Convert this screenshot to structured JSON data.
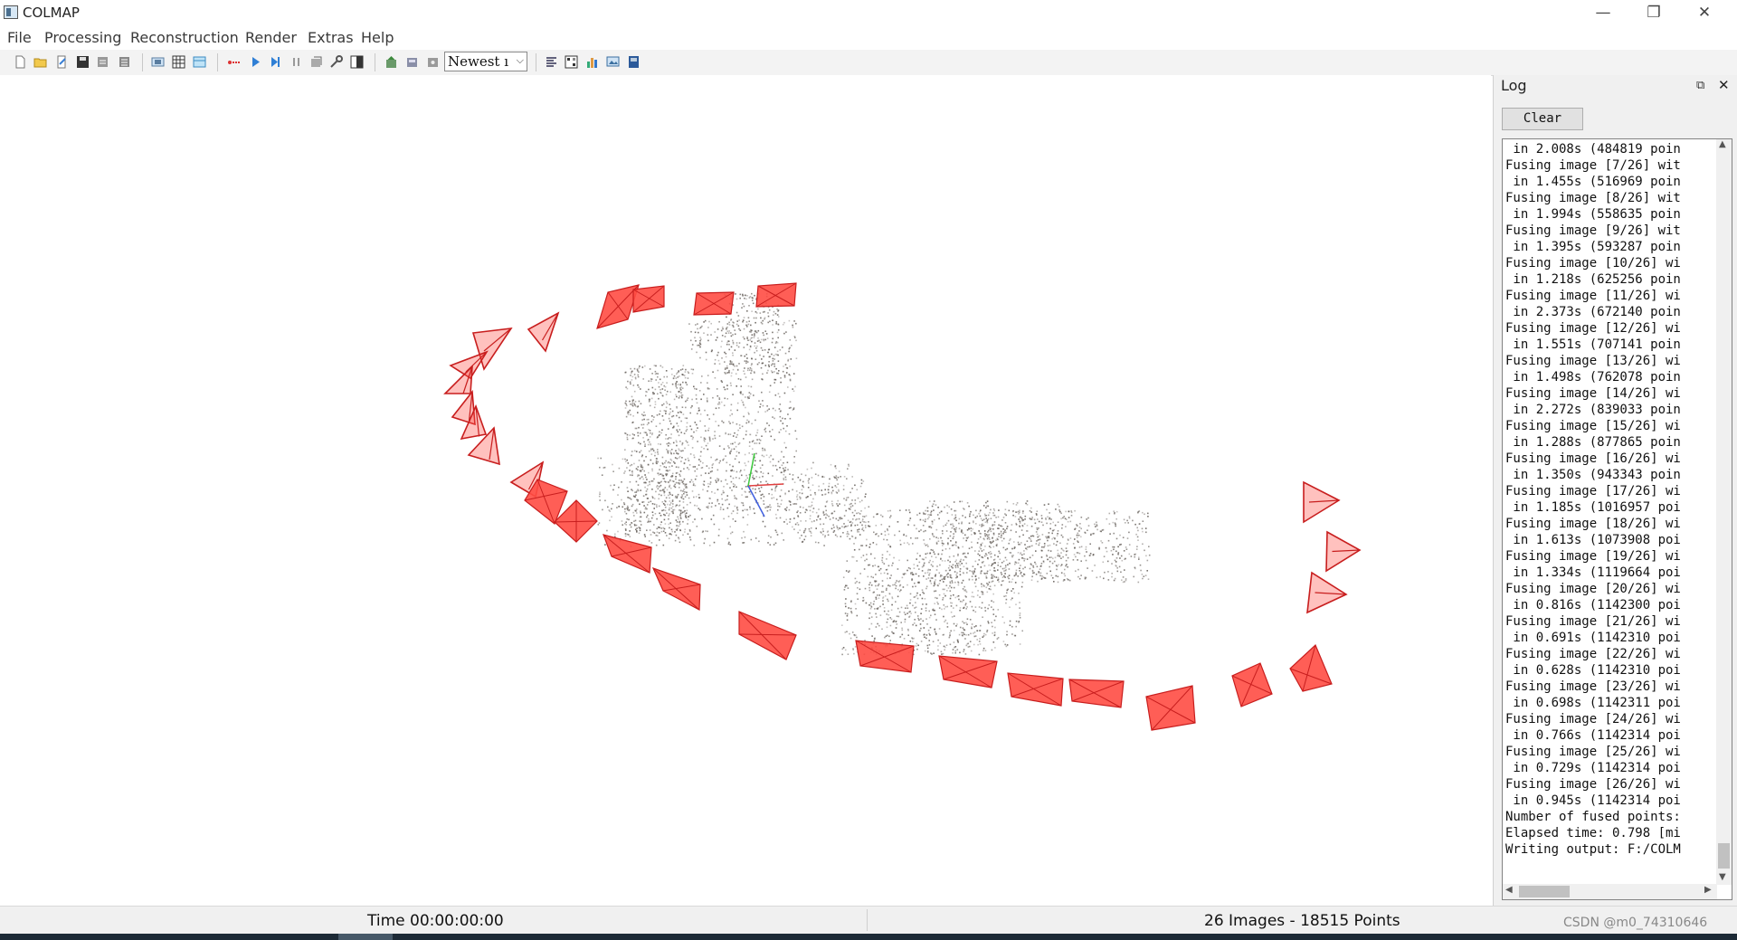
{
  "window": {
    "title": "COLMAP",
    "minimize": "—",
    "restore": "❐",
    "close": "✕"
  },
  "menu": [
    "File",
    "Processing",
    "Reconstruction",
    "Render",
    "Extras",
    "Help"
  ],
  "toolbar": {
    "selector_value": "Newest ı",
    "icons": [
      "new-project-icon",
      "open-project-icon",
      "edit-project-icon",
      "save-project-icon",
      "import-model-icon",
      "export-model-icon",
      "feature-extraction-icon",
      "feature-matching-icon",
      "database-management-icon",
      "automatic-reconstruction-icon",
      "reconstruction-start-icon",
      "reconstruction-step-icon",
      "reconstruction-pause-icon",
      "reconstruction-options-icon",
      "bundle-adjustment-icon",
      "dense-reconstruction-icon",
      "render-toggle-icon",
      "render-reset-icon",
      "render-options-icon",
      "reconstruction-stats-icon",
      "match-matrix-icon",
      "show-log-icon",
      "grab-image-icon",
      "grab-movie-icon"
    ]
  },
  "colors": {
    "camera_fill": "#ff4c44",
    "camera_edge": "#c81e1e",
    "points": "#6b6560",
    "axis_x": "#e04040",
    "axis_y": "#3cc83c",
    "axis_z": "#4060e0"
  },
  "log": {
    "title": "Log",
    "float_icon": "⧉",
    "close_icon": "✕",
    "clear_label": "Clear",
    "lines": [
      " in 2.008s (484819 poin",
      "Fusing image [7/26] wit",
      " in 1.455s (516969 poin",
      "Fusing image [8/26] wit",
      " in 1.994s (558635 poin",
      "Fusing image [9/26] wit",
      " in 1.395s (593287 poin",
      "Fusing image [10/26] wi",
      " in 1.218s (625256 poin",
      "Fusing image [11/26] wi",
      " in 2.373s (672140 poin",
      "Fusing image [12/26] wi",
      " in 1.551s (707141 poin",
      "Fusing image [13/26] wi",
      " in 1.498s (762078 poin",
      "Fusing image [14/26] wi",
      " in 2.272s (839033 poin",
      "Fusing image [15/26] wi",
      " in 1.288s (877865 poin",
      "Fusing image [16/26] wi",
      " in 1.350s (943343 poin",
      "Fusing image [17/26] wi",
      " in 1.185s (1016957 poi",
      "Fusing image [18/26] wi",
      " in 1.613s (1073908 poi",
      "Fusing image [19/26] wi",
      " in 1.334s (1119664 poi",
      "Fusing image [20/26] wi",
      " in 0.816s (1142300 poi",
      "Fusing image [21/26] wi",
      " in 0.691s (1142310 poi",
      "Fusing image [22/26] wi",
      " in 0.628s (1142310 poi",
      "Fusing image [23/26] wi",
      " in 0.698s (1142311 poi",
      "Fusing image [24/26] wi",
      " in 0.766s (1142314 poi",
      "Fusing image [25/26] wi",
      " in 0.729s (1142314 poi",
      "Fusing image [26/26] wi",
      " in 0.945s (1142314 poi",
      "Number of fused points:",
      "Elapsed time: 0.798 [mi",
      "Writing output: F:/COLM"
    ]
  },
  "status": {
    "time": "Time 00:00:00:00",
    "counts": "26 Images - 18515 Points"
  },
  "watermark": "CSDN @m0_74310646"
}
